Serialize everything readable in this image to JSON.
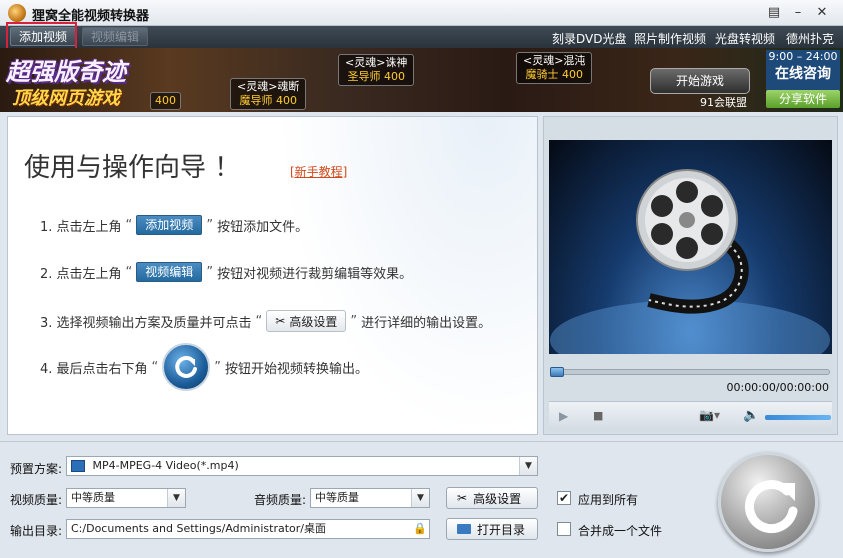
{
  "window": {
    "title": "狸窝全能视频转换器"
  },
  "toolbar": {
    "add_video": "添加视频",
    "edit_video": "视频编辑"
  },
  "top_links": [
    "刻录DVD光盘",
    "照片制作视频",
    "光盘转视频",
    "德州扑克"
  ],
  "banner": {
    "title": "超强版奇迹",
    "subtitle": "顶级网页游戏",
    "tags": [
      {
        "name": "<灵魂>诛神",
        "role": "圣导师 400"
      },
      {
        "name": "<灵魂>混沌",
        "role": "魔骑士 400"
      },
      {
        "name": "<灵魂>魂断",
        "role": "魔导师 400"
      }
    ],
    "partial_level": "400",
    "start_game": "开始游戏",
    "alliance": "91会联盟",
    "hours": "9:00 – 24:00",
    "consult": "在线咨询",
    "share": "分享软件"
  },
  "guide": {
    "title": "使用与操作向导 ！",
    "tutorial_link": "[新手教程]",
    "step1_prefix": "1. 点击左上角",
    "step1_button": "添加视频",
    "step1_suffix": "按钮添加文件。",
    "step2_prefix": "2. 点击左上角",
    "step2_button": "视频编辑",
    "step2_suffix": "按钮对视频进行裁剪编辑等效果。",
    "step3_prefix": "3. 选择视频输出方案及质量并可点击",
    "step3_button": "高级设置",
    "step3_suffix": "进行详细的输出设置。",
    "step4_prefix": "4. 最后点击右下角",
    "step4_suffix": "按钮开始视频转换输出。",
    "open_quote": "“",
    "close_quote": "”"
  },
  "player": {
    "timecode": "00:00:00/00:00:00",
    "progress": 0,
    "volume": 1.0
  },
  "settings": {
    "preset_label": "预置方案:",
    "preset_value": "MP4-MPEG-4 Video(*.mp4)",
    "video_quality_label": "视频质量:",
    "video_quality_value": "中等质量",
    "audio_quality_label": "音频质量:",
    "audio_quality_value": "中等质量",
    "advanced_button": "高级设置",
    "apply_all_label": "应用到所有",
    "apply_all_checked": true,
    "output_dir_label": "输出目录:",
    "output_dir_value": "C:/Documents and Settings/Administrator/桌面",
    "open_dir_button": "打开目录",
    "merge_label": "合并成一个文件",
    "merge_checked": false
  },
  "colors": {
    "accent": "#236a9f",
    "highlight_box": "#d6223a",
    "link": "#d24a1a"
  }
}
